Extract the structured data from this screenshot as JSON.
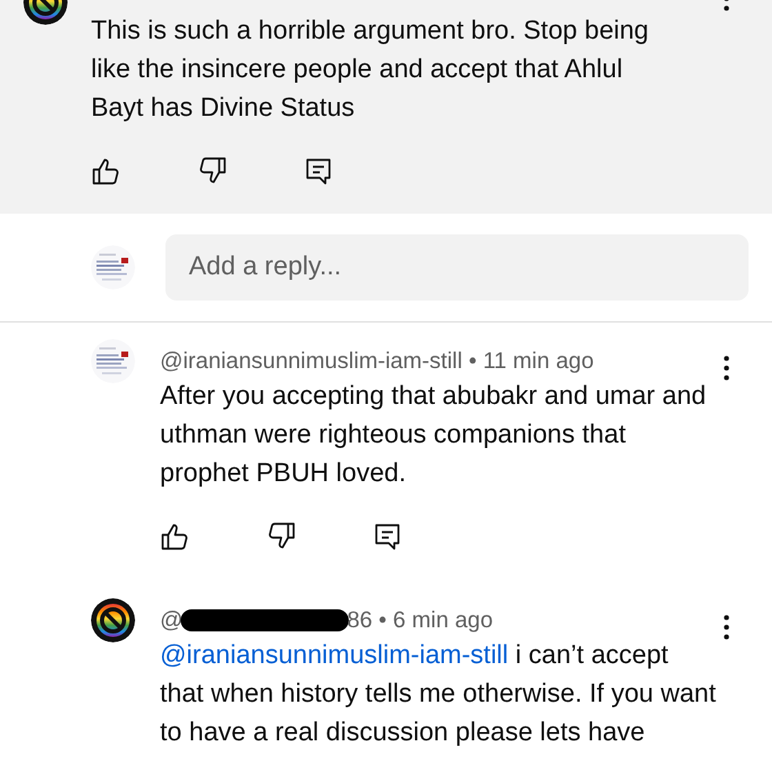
{
  "top_comment": {
    "avatar": {
      "kind": "logo"
    },
    "body": "This is such a horrible argument bro. Stop being like the insincere people and accept that Ahlul Bayt has Divine Status"
  },
  "reply_box": {
    "avatar": {
      "kind": "picture"
    },
    "placeholder": "Add a reply..."
  },
  "replies": [
    {
      "avatar": {
        "kind": "picture"
      },
      "redacted": false,
      "meta": [
        "@iraniansunnimuslim-iam-still • 11 min ago"
      ],
      "body": "After you accepting that abubakr and umar and uthman were righteous companions that prophet PBUH loved.",
      "actions": true
    },
    {
      "avatar": {
        "kind": "logo"
      },
      "redacted": true,
      "meta": [
        "@",
        "86 • 6 min ago"
      ],
      "mention": "@iraniansunnimuslim-iam-still",
      "body": "i can’t accept that when history tells me otherwise. If you want to have a real discussion please lets have",
      "actions": false
    }
  ]
}
